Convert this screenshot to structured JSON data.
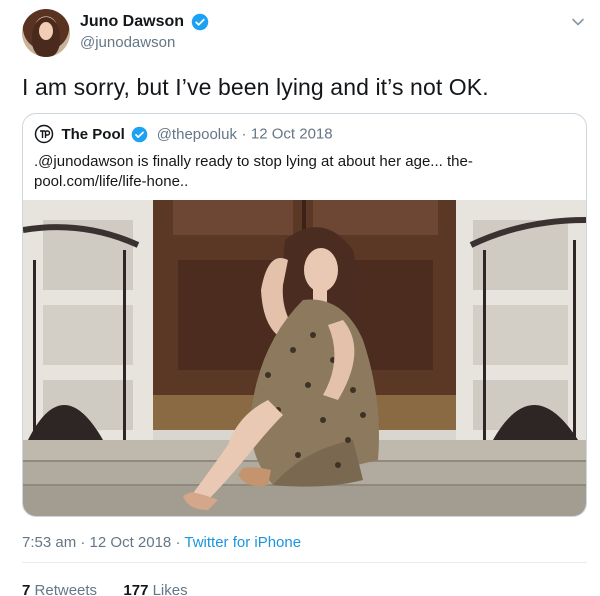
{
  "author": {
    "name": "Juno Dawson",
    "handle": "@junodawson"
  },
  "tweet": {
    "text": "I am sorry, but I’ve been lying and it’s not OK."
  },
  "quote": {
    "name": "The Pool",
    "handle": "@thepooluk",
    "separator": "·",
    "date": "12 Oct 2018",
    "text": ".@junodawson is finally ready to stop lying at about her age... the-pool.com/life/life-hone.."
  },
  "meta": {
    "time": "7:53 am",
    "separator1": "·",
    "date": "12 Oct 2018",
    "separator2": "·",
    "source": "Twitter for iPhone"
  },
  "stats": {
    "retweets_count": "7",
    "retweets_label": "Retweets",
    "likes_count": "177",
    "likes_label": "Likes"
  },
  "icons": {
    "verified": "verified-badge-icon",
    "menu": "chevron-down-icon",
    "logo": "the-pool-logo-icon"
  },
  "colors": {
    "verified": "#1da1f2",
    "link": "#1b95e0",
    "muted": "#657786",
    "border": "#ccd6dd"
  }
}
